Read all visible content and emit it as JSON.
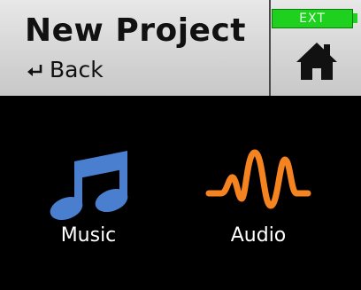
{
  "header": {
    "title": "New Project",
    "back_label": "Back",
    "back_icon": "return-arrow-icon",
    "status_badge": "EXT",
    "home_icon": "home-icon"
  },
  "options": [
    {
      "label": "Music",
      "icon": "music-note-icon"
    },
    {
      "label": "Audio",
      "icon": "waveform-icon"
    }
  ],
  "colors": {
    "header_bg": "#d4d4d4",
    "screen_bg": "#000000",
    "badge_green": "#1fd11f",
    "music_blue": "#4a7fd0",
    "audio_orange": "#f5831f",
    "text_dark": "#111111",
    "text_light": "#ffffff"
  }
}
